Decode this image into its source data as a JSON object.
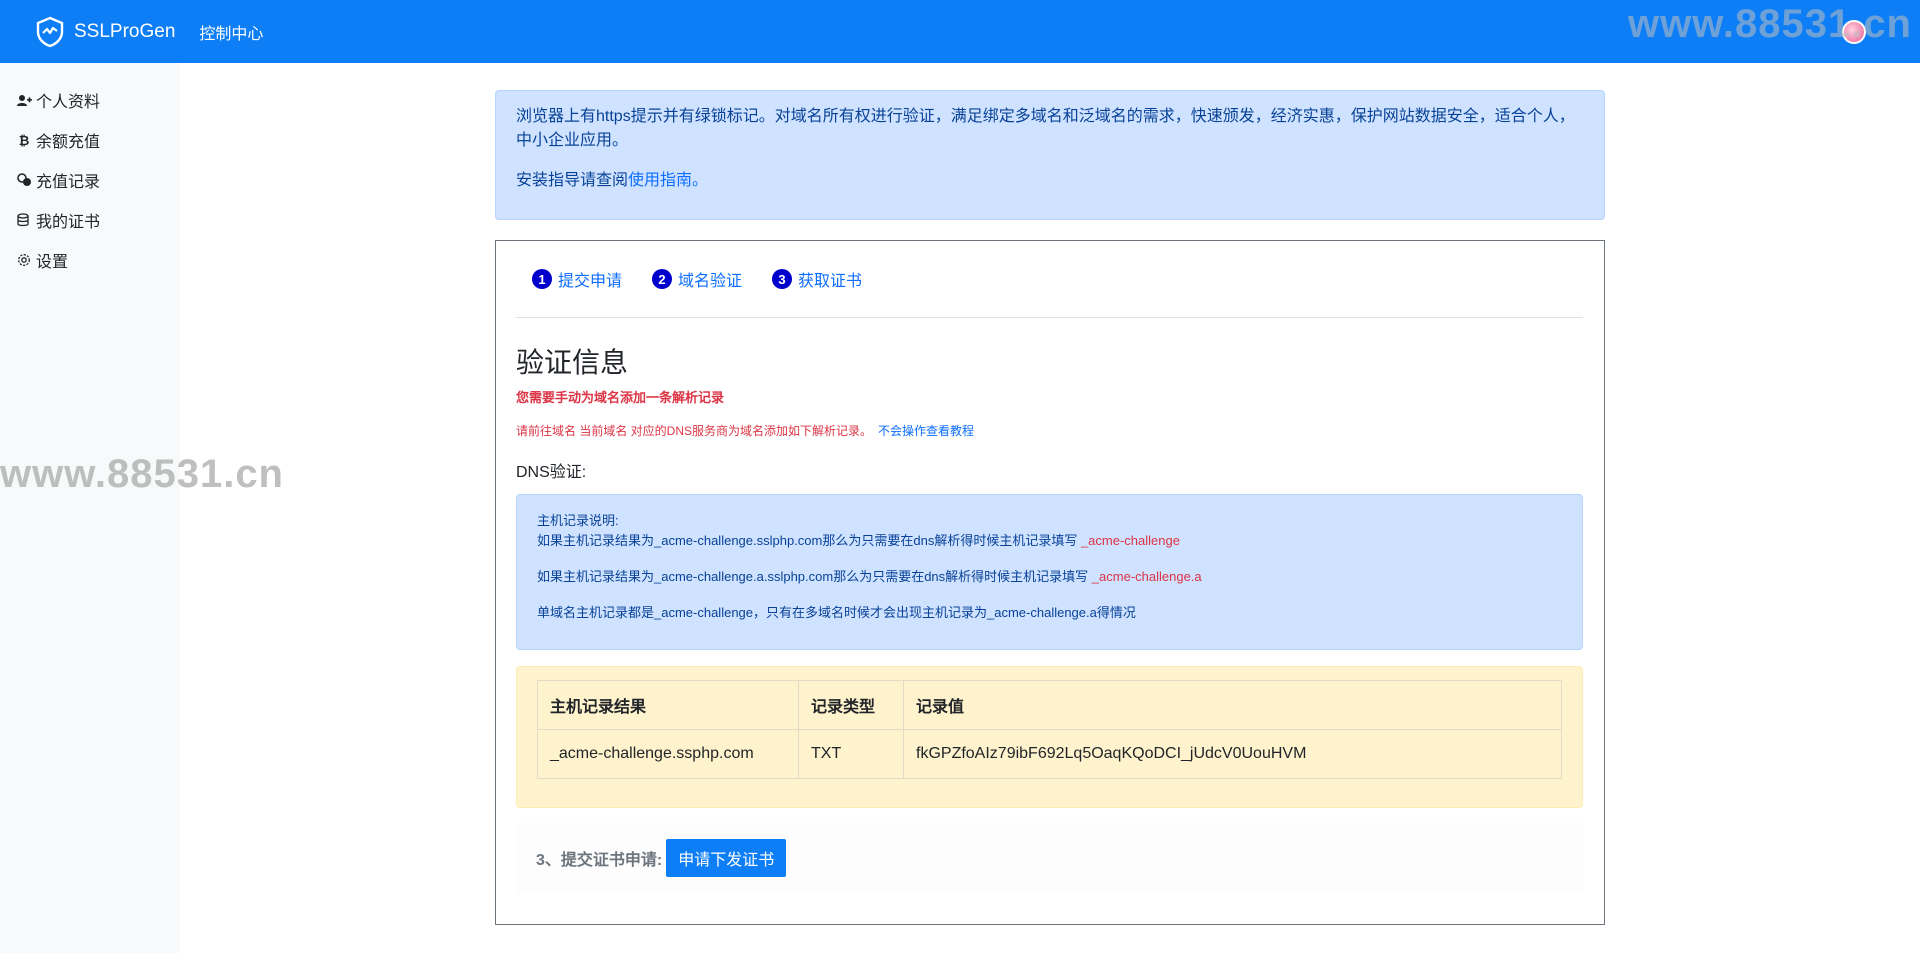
{
  "header": {
    "brand": "SSLProGen",
    "nav_link": "控制中心",
    "watermark": "www.88531.cn"
  },
  "sidebar": {
    "items": [
      {
        "label": "个人资料",
        "icon": "user-plus-icon"
      },
      {
        "label": "余额充值",
        "icon": "bitcoin-icon"
      },
      {
        "label": "充值记录",
        "icon": "coins-icon"
      },
      {
        "label": "我的证书",
        "icon": "database-icon"
      },
      {
        "label": "设置",
        "icon": "gear-icon"
      }
    ]
  },
  "watermark_left": "www.88531.cn",
  "info": {
    "line1": "浏览器上有https提示并有绿锁标记。对域名所有权进行验证，满足绑定多域名和泛域名的需求，快速颁发，经济实惠，保护网站数据安全，适合个人，中小企业应用。",
    "line2_prefix": "安装指导请查阅",
    "line2_link": "使用指南",
    "line2_suffix": "。"
  },
  "steps": [
    {
      "num": "1",
      "label": "提交申请"
    },
    {
      "num": "2",
      "label": "域名验证"
    },
    {
      "num": "3",
      "label": "获取证书"
    }
  ],
  "verify": {
    "title": "验证信息",
    "warn_bold": "您需要手动为域名添加一条解析记录",
    "warn_line": "请前往域名 当前域名 对应的DNS服务商为域名添加如下解析记录。",
    "warn_link": "不会操作查看教程",
    "dns_label": "DNS验证:"
  },
  "host_notes": {
    "title": "主机记录说明:",
    "line1": "如果主机记录结果为_acme-challenge.sslphp.com那么为只需要在dns解析得时候主机记录填写",
    "line1_red": "_acme-challenge",
    "line2": "如果主机记录结果为_acme-challenge.a.sslphp.com那么为只需要在dns解析得时候主机记录填写",
    "line2_red": "_acme-challenge.a",
    "line3": "单域名主机记录都是_acme-challenge，只有在多域名时候才会出现主机记录为_acme-challenge.a得情况"
  },
  "record_table": {
    "headers": [
      "主机记录结果",
      "记录类型",
      "记录值"
    ],
    "rows": [
      [
        "_acme-challenge.ssphp.com",
        "TXT",
        "fkGPZfoAIz79ibF692Lq5OaqKQoDCI_jUdcV0UouHVM"
      ]
    ]
  },
  "submit": {
    "label": "3、提交证书申请:",
    "button": "申请下发证书"
  },
  "colors": {
    "primary": "#0d7ef5",
    "info_bg": "#cfe2ff",
    "warning_bg": "#fff3cd",
    "danger": "#dc3545"
  }
}
